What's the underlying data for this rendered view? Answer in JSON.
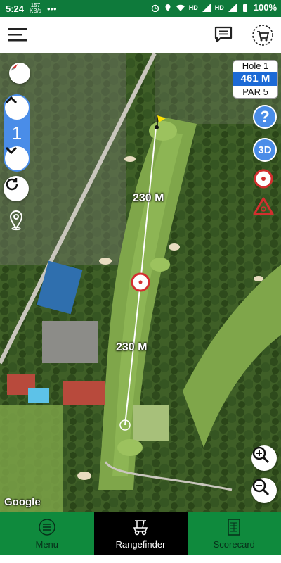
{
  "status_bar": {
    "time": "5:24",
    "net_speed_value": "157",
    "net_speed_unit": "KB/s",
    "network_type_1": "HD",
    "network_type_2": "HD",
    "battery": "100%"
  },
  "header": {
    "menu_icon": "hamburger-icon",
    "chat_icon": "chat-icon",
    "cart_icon": "shop-cart-icon"
  },
  "map": {
    "attribution": "Google",
    "hole_number": "1",
    "hole_label": "Hole 1",
    "hole_distance": "461 M",
    "par_label": "PAR 5",
    "distance_to_target": "230 M",
    "distance_to_green": "230 M",
    "help_label": "?",
    "view_3d_label": "3D"
  },
  "nav": {
    "items": [
      {
        "label": "Menu",
        "icon": "menu-circle-icon"
      },
      {
        "label": "Rangefinder",
        "icon": "golf-cart-icon"
      },
      {
        "label": "Scorecard",
        "icon": "scorecard-icon"
      }
    ]
  },
  "colors": {
    "brand_green": "#0f8a3d",
    "accent_blue": "#4a8de8",
    "hole_distance_blue": "#1c6ad6",
    "target_red": "#d32f2f"
  }
}
